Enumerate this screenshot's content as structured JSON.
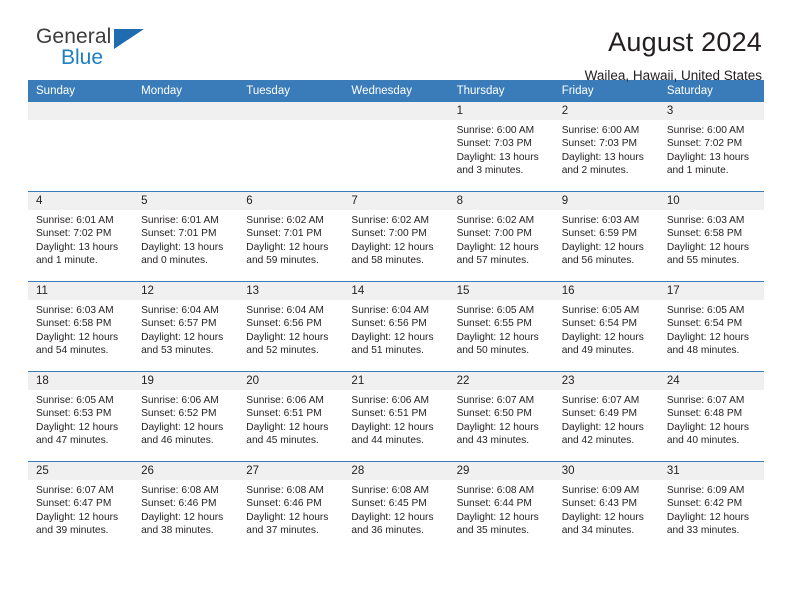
{
  "brand": {
    "name_top": "General",
    "name_bottom": "Blue",
    "flag_icon": "blue-triangle-flag",
    "accent_color": "#1d7fc3"
  },
  "header": {
    "month_title": "August 2024",
    "location": "Wailea, Hawaii, United States"
  },
  "calendar": {
    "header_bg": "#3a7cba",
    "daynum_bg": "#f0f0f0",
    "weekdays": [
      "Sunday",
      "Monday",
      "Tuesday",
      "Wednesday",
      "Thursday",
      "Friday",
      "Saturday"
    ],
    "weeks": [
      [
        {
          "day": "",
          "empty": true
        },
        {
          "day": "",
          "empty": true
        },
        {
          "day": "",
          "empty": true
        },
        {
          "day": "",
          "empty": true
        },
        {
          "day": "1",
          "sunrise": "Sunrise: 6:00 AM",
          "sunset": "Sunset: 7:03 PM",
          "daylight": "Daylight: 13 hours and 3 minutes."
        },
        {
          "day": "2",
          "sunrise": "Sunrise: 6:00 AM",
          "sunset": "Sunset: 7:03 PM",
          "daylight": "Daylight: 13 hours and 2 minutes."
        },
        {
          "day": "3",
          "sunrise": "Sunrise: 6:00 AM",
          "sunset": "Sunset: 7:02 PM",
          "daylight": "Daylight: 13 hours and 1 minute."
        }
      ],
      [
        {
          "day": "4",
          "sunrise": "Sunrise: 6:01 AM",
          "sunset": "Sunset: 7:02 PM",
          "daylight": "Daylight: 13 hours and 1 minute."
        },
        {
          "day": "5",
          "sunrise": "Sunrise: 6:01 AM",
          "sunset": "Sunset: 7:01 PM",
          "daylight": "Daylight: 13 hours and 0 minutes."
        },
        {
          "day": "6",
          "sunrise": "Sunrise: 6:02 AM",
          "sunset": "Sunset: 7:01 PM",
          "daylight": "Daylight: 12 hours and 59 minutes."
        },
        {
          "day": "7",
          "sunrise": "Sunrise: 6:02 AM",
          "sunset": "Sunset: 7:00 PM",
          "daylight": "Daylight: 12 hours and 58 minutes."
        },
        {
          "day": "8",
          "sunrise": "Sunrise: 6:02 AM",
          "sunset": "Sunset: 7:00 PM",
          "daylight": "Daylight: 12 hours and 57 minutes."
        },
        {
          "day": "9",
          "sunrise": "Sunrise: 6:03 AM",
          "sunset": "Sunset: 6:59 PM",
          "daylight": "Daylight: 12 hours and 56 minutes."
        },
        {
          "day": "10",
          "sunrise": "Sunrise: 6:03 AM",
          "sunset": "Sunset: 6:58 PM",
          "daylight": "Daylight: 12 hours and 55 minutes."
        }
      ],
      [
        {
          "day": "11",
          "sunrise": "Sunrise: 6:03 AM",
          "sunset": "Sunset: 6:58 PM",
          "daylight": "Daylight: 12 hours and 54 minutes."
        },
        {
          "day": "12",
          "sunrise": "Sunrise: 6:04 AM",
          "sunset": "Sunset: 6:57 PM",
          "daylight": "Daylight: 12 hours and 53 minutes."
        },
        {
          "day": "13",
          "sunrise": "Sunrise: 6:04 AM",
          "sunset": "Sunset: 6:56 PM",
          "daylight": "Daylight: 12 hours and 52 minutes."
        },
        {
          "day": "14",
          "sunrise": "Sunrise: 6:04 AM",
          "sunset": "Sunset: 6:56 PM",
          "daylight": "Daylight: 12 hours and 51 minutes."
        },
        {
          "day": "15",
          "sunrise": "Sunrise: 6:05 AM",
          "sunset": "Sunset: 6:55 PM",
          "daylight": "Daylight: 12 hours and 50 minutes."
        },
        {
          "day": "16",
          "sunrise": "Sunrise: 6:05 AM",
          "sunset": "Sunset: 6:54 PM",
          "daylight": "Daylight: 12 hours and 49 minutes."
        },
        {
          "day": "17",
          "sunrise": "Sunrise: 6:05 AM",
          "sunset": "Sunset: 6:54 PM",
          "daylight": "Daylight: 12 hours and 48 minutes."
        }
      ],
      [
        {
          "day": "18",
          "sunrise": "Sunrise: 6:05 AM",
          "sunset": "Sunset: 6:53 PM",
          "daylight": "Daylight: 12 hours and 47 minutes."
        },
        {
          "day": "19",
          "sunrise": "Sunrise: 6:06 AM",
          "sunset": "Sunset: 6:52 PM",
          "daylight": "Daylight: 12 hours and 46 minutes."
        },
        {
          "day": "20",
          "sunrise": "Sunrise: 6:06 AM",
          "sunset": "Sunset: 6:51 PM",
          "daylight": "Daylight: 12 hours and 45 minutes."
        },
        {
          "day": "21",
          "sunrise": "Sunrise: 6:06 AM",
          "sunset": "Sunset: 6:51 PM",
          "daylight": "Daylight: 12 hours and 44 minutes."
        },
        {
          "day": "22",
          "sunrise": "Sunrise: 6:07 AM",
          "sunset": "Sunset: 6:50 PM",
          "daylight": "Daylight: 12 hours and 43 minutes."
        },
        {
          "day": "23",
          "sunrise": "Sunrise: 6:07 AM",
          "sunset": "Sunset: 6:49 PM",
          "daylight": "Daylight: 12 hours and 42 minutes."
        },
        {
          "day": "24",
          "sunrise": "Sunrise: 6:07 AM",
          "sunset": "Sunset: 6:48 PM",
          "daylight": "Daylight: 12 hours and 40 minutes."
        }
      ],
      [
        {
          "day": "25",
          "sunrise": "Sunrise: 6:07 AM",
          "sunset": "Sunset: 6:47 PM",
          "daylight": "Daylight: 12 hours and 39 minutes."
        },
        {
          "day": "26",
          "sunrise": "Sunrise: 6:08 AM",
          "sunset": "Sunset: 6:46 PM",
          "daylight": "Daylight: 12 hours and 38 minutes."
        },
        {
          "day": "27",
          "sunrise": "Sunrise: 6:08 AM",
          "sunset": "Sunset: 6:46 PM",
          "daylight": "Daylight: 12 hours and 37 minutes."
        },
        {
          "day": "28",
          "sunrise": "Sunrise: 6:08 AM",
          "sunset": "Sunset: 6:45 PM",
          "daylight": "Daylight: 12 hours and 36 minutes."
        },
        {
          "day": "29",
          "sunrise": "Sunrise: 6:08 AM",
          "sunset": "Sunset: 6:44 PM",
          "daylight": "Daylight: 12 hours and 35 minutes."
        },
        {
          "day": "30",
          "sunrise": "Sunrise: 6:09 AM",
          "sunset": "Sunset: 6:43 PM",
          "daylight": "Daylight: 12 hours and 34 minutes."
        },
        {
          "day": "31",
          "sunrise": "Sunrise: 6:09 AM",
          "sunset": "Sunset: 6:42 PM",
          "daylight": "Daylight: 12 hours and 33 minutes."
        }
      ]
    ]
  }
}
